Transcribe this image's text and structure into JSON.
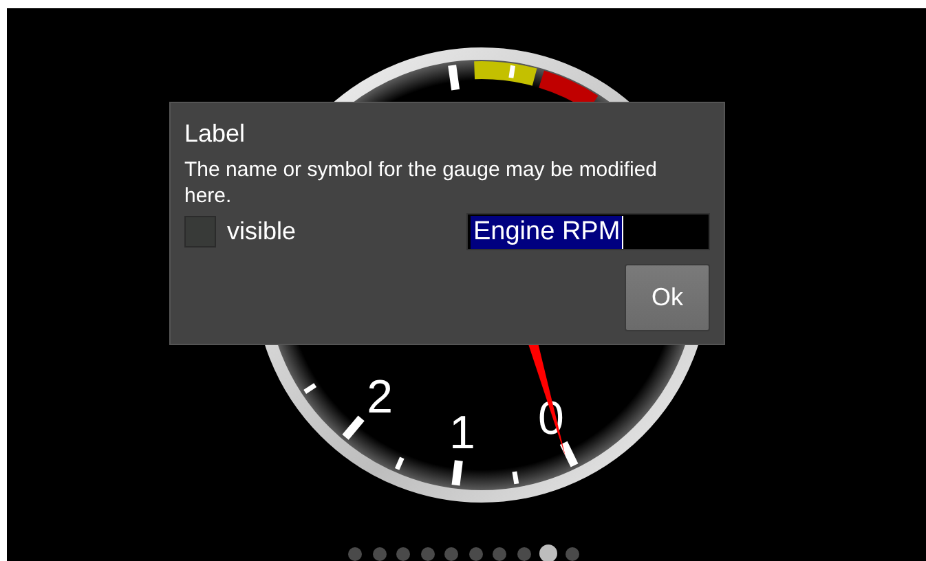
{
  "gauge": {
    "labels": [
      {
        "text": "0"
      },
      {
        "text": "1"
      },
      {
        "text": "2"
      }
    ]
  },
  "dialog": {
    "title": "Label",
    "message": "The name or symbol for the gauge may be modified here.",
    "checkbox": {
      "label": "visible",
      "checked": false
    },
    "field": {
      "value": "Engine RPM",
      "text_selected": true
    },
    "buttons": [
      "Ok"
    ]
  },
  "pager": [
    {
      "selected": false
    },
    {
      "selected": false
    },
    {
      "selected": false
    },
    {
      "selected": false
    },
    {
      "selected": false
    },
    {
      "selected": false
    },
    {
      "selected": false
    },
    {
      "selected": false
    },
    {
      "selected": true
    },
    {
      "selected": false
    }
  ]
}
